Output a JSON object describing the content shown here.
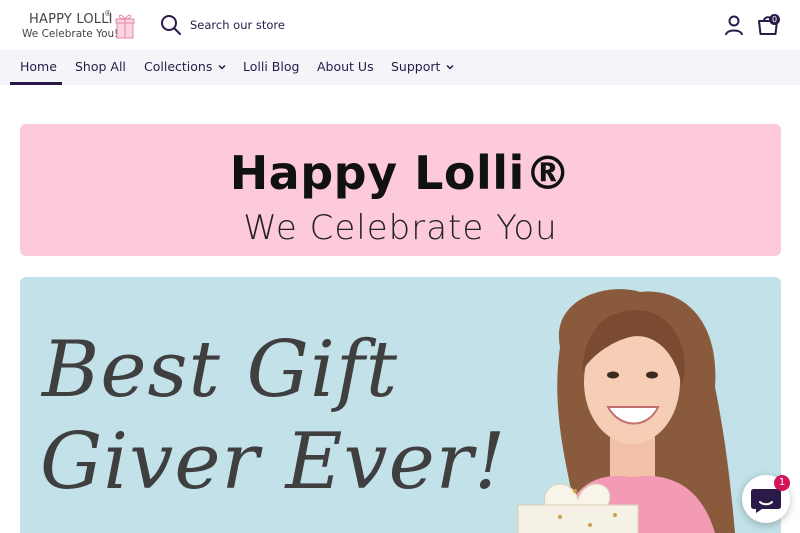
{
  "logo": {
    "line1": "HAPPY LOLLI",
    "registered": "®",
    "line2": "We Celebrate You!",
    "gift_icon": "gift-box-icon"
  },
  "search": {
    "placeholder": "Search our store",
    "icon": "search-icon"
  },
  "header_icons": {
    "account": "account-icon",
    "cart": "cart-icon",
    "cart_count": "0"
  },
  "nav": {
    "items": [
      {
        "label": "Home",
        "active": true
      },
      {
        "label": "Shop All"
      },
      {
        "label": "Collections",
        "dropdown": true
      },
      {
        "label": "Lolli Blog"
      },
      {
        "label": "About Us"
      },
      {
        "label": "Support",
        "dropdown": true
      }
    ]
  },
  "banner": {
    "title": "Happy Lolli®",
    "subtitle": "We Celebrate You",
    "background": "#fcc9dd"
  },
  "hero": {
    "line1": "Best Gift",
    "line2": "Giver Ever!",
    "background": "#c2e1e8"
  },
  "chat": {
    "icon": "chat-icon",
    "badge": "1"
  },
  "colors": {
    "brand_text": "#2a1a4a",
    "nav_bg": "#f4f5f8",
    "badge": "#d4145a"
  }
}
